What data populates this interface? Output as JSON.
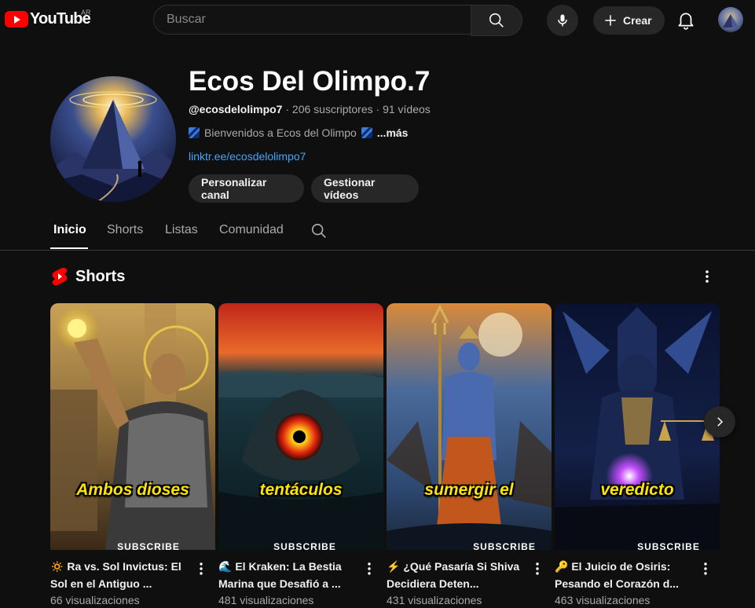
{
  "colors": {
    "background": "#0f0f0f",
    "accent_red": "#ff0000",
    "link_blue": "#3ea6ff",
    "caption_yellow": "#ffe600"
  },
  "topbar": {
    "logo_text": "YouTube",
    "country_code": "AR",
    "search_placeholder": "Buscar",
    "create_label": "Crear",
    "icons": [
      "search-icon",
      "mic-icon",
      "plus-icon",
      "bell-icon"
    ]
  },
  "channel": {
    "name": "Ecos Del Olimpo.7",
    "handle": "@ecosdelolimpo7",
    "meta": " · 206 suscriptores · 91 vídeos",
    "description": "Bienvenidos a Ecos del Olimpo",
    "more_label": "...más",
    "link": "linktr.ee/ecosdelolimpo7",
    "customize_label": "Personalizar canal",
    "manage_label": "Gestionar vídeos"
  },
  "tabs": [
    {
      "label": "Inicio",
      "active": true
    },
    {
      "label": "Shorts",
      "active": false
    },
    {
      "label": "Listas",
      "active": false
    },
    {
      "label": "Comunidad",
      "active": false
    }
  ],
  "shorts_section": {
    "title": "Shorts",
    "items": [
      {
        "emoji": "🔅",
        "title": "Ra vs. Sol Invictus: El Sol en el Antiguo ...",
        "views": "66 visualizaciones",
        "caption": "Ambos dioses",
        "strip": "SUBSCRIBE"
      },
      {
        "emoji": "🌊",
        "title": "El Kraken: La Bestia Marina que Desafió a ...",
        "views": "481 visualizaciones",
        "caption": "tentáculos",
        "strip": "SUBSCRIBE"
      },
      {
        "emoji": "⚡",
        "title": "¿Qué Pasaría Si Shiva Decidiera Deten...",
        "views": "431 visualizaciones",
        "caption": "sumergir el",
        "strip": "SUBSCRIBE"
      },
      {
        "emoji": "🔑",
        "title": "El Juicio de Osiris: Pesando el Corazón d...",
        "views": "463 visualizaciones",
        "caption": "veredicto",
        "strip": "SUBSCRIBE"
      }
    ]
  }
}
